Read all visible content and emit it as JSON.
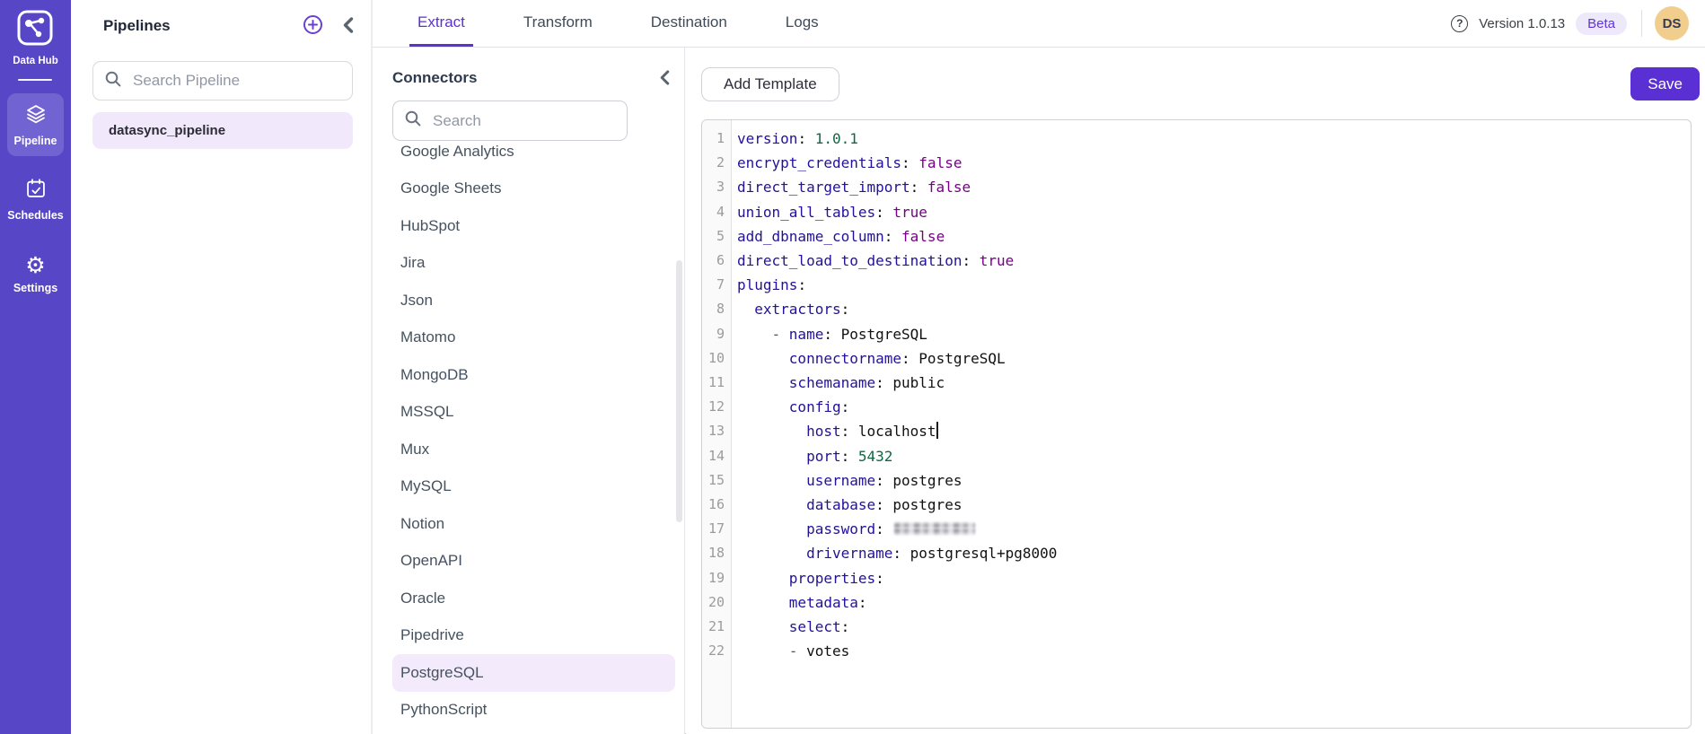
{
  "colors": {
    "sidebar_bg": "#5746C6",
    "sidebar_active_bg": "#7163D1",
    "accent": "#5F2FD0",
    "save_button_bg": "#5A2FD4",
    "selected_item_bg": "#F3EAFB",
    "beta_badge_bg": "#EDE8FA",
    "beta_badge_text": "#5F35D6",
    "avatar_bg": "#F1CE8E",
    "code_key": "#221199",
    "code_number": "#116644",
    "code_keyword": "#770088"
  },
  "sidebar": {
    "app_name": "Data Hub",
    "items": [
      {
        "label": "Pipeline",
        "icon": "layers-icon",
        "active": true
      },
      {
        "label": "Schedules",
        "icon": "calendar-check-icon",
        "active": false
      },
      {
        "label": "Settings",
        "icon": "gear-icon",
        "active": false
      }
    ]
  },
  "pipelines_panel": {
    "title": "Pipelines",
    "search_placeholder": "Search Pipeline",
    "items": [
      {
        "label": "datasync_pipeline",
        "selected": true
      }
    ]
  },
  "tabs": [
    {
      "label": "Extract",
      "active": true
    },
    {
      "label": "Transform",
      "active": false
    },
    {
      "label": "Destination",
      "active": false
    },
    {
      "label": "Logs",
      "active": false
    }
  ],
  "topbar_right": {
    "version_label": "Version 1.0.13",
    "beta_label": "Beta",
    "avatar_initials": "DS"
  },
  "connectors": {
    "title": "Connectors",
    "search_placeholder": "Search",
    "items": [
      {
        "label": "Google Analytics",
        "selected": false
      },
      {
        "label": "Google Sheets",
        "selected": false
      },
      {
        "label": "HubSpot",
        "selected": false
      },
      {
        "label": "Jira",
        "selected": false
      },
      {
        "label": "Json",
        "selected": false
      },
      {
        "label": "Matomo",
        "selected": false
      },
      {
        "label": "MongoDB",
        "selected": false
      },
      {
        "label": "MSSQL",
        "selected": false
      },
      {
        "label": "Mux",
        "selected": false
      },
      {
        "label": "MySQL",
        "selected": false
      },
      {
        "label": "Notion",
        "selected": false
      },
      {
        "label": "OpenAPI",
        "selected": false
      },
      {
        "label": "Oracle",
        "selected": false
      },
      {
        "label": "Pipedrive",
        "selected": false
      },
      {
        "label": "PostgreSQL",
        "selected": true
      },
      {
        "label": "PythonScript",
        "selected": false
      }
    ]
  },
  "toolbar": {
    "add_template_label": "Add Template",
    "save_label": "Save"
  },
  "editor": {
    "lines": [
      {
        "tokens": [
          [
            "key",
            "version"
          ],
          [
            "plain",
            ": "
          ],
          [
            "num",
            "1.0.1"
          ]
        ]
      },
      {
        "tokens": [
          [
            "key",
            "encrypt_credentials"
          ],
          [
            "plain",
            ": "
          ],
          [
            "bool",
            "false"
          ]
        ]
      },
      {
        "tokens": [
          [
            "key",
            "direct_target_import"
          ],
          [
            "plain",
            ": "
          ],
          [
            "bool",
            "false"
          ]
        ]
      },
      {
        "tokens": [
          [
            "key",
            "union_all_tables"
          ],
          [
            "plain",
            ": "
          ],
          [
            "bool",
            "true"
          ]
        ]
      },
      {
        "tokens": [
          [
            "key",
            "add_dbname_column"
          ],
          [
            "plain",
            ": "
          ],
          [
            "bool",
            "false"
          ]
        ]
      },
      {
        "tokens": [
          [
            "key",
            "direct_load_to_destination"
          ],
          [
            "plain",
            ": "
          ],
          [
            "bool",
            "true"
          ]
        ]
      },
      {
        "tokens": [
          [
            "key",
            "plugins"
          ],
          [
            "plain",
            ":"
          ]
        ]
      },
      {
        "tokens": [
          [
            "plain",
            "  "
          ],
          [
            "key",
            "extractors"
          ],
          [
            "plain",
            ":"
          ]
        ]
      },
      {
        "tokens": [
          [
            "plain",
            "    "
          ],
          [
            "dash",
            "- "
          ],
          [
            "key",
            "name"
          ],
          [
            "plain",
            ": "
          ],
          [
            "str",
            "PostgreSQL"
          ]
        ]
      },
      {
        "tokens": [
          [
            "plain",
            "      "
          ],
          [
            "key",
            "connectorname"
          ],
          [
            "plain",
            ": "
          ],
          [
            "str",
            "PostgreSQL"
          ]
        ]
      },
      {
        "tokens": [
          [
            "plain",
            "      "
          ],
          [
            "key",
            "schemaname"
          ],
          [
            "plain",
            ": "
          ],
          [
            "str",
            "public"
          ]
        ]
      },
      {
        "tokens": [
          [
            "plain",
            "      "
          ],
          [
            "key",
            "config"
          ],
          [
            "plain",
            ":"
          ]
        ]
      },
      {
        "tokens": [
          [
            "plain",
            "        "
          ],
          [
            "key",
            "host"
          ],
          [
            "plain",
            ": "
          ],
          [
            "str",
            "localhost"
          ],
          [
            "cursor",
            ""
          ]
        ]
      },
      {
        "tokens": [
          [
            "plain",
            "        "
          ],
          [
            "key",
            "port"
          ],
          [
            "plain",
            ": "
          ],
          [
            "num",
            "5432"
          ]
        ]
      },
      {
        "tokens": [
          [
            "plain",
            "        "
          ],
          [
            "key",
            "username"
          ],
          [
            "plain",
            ": "
          ],
          [
            "str",
            "postgres"
          ]
        ]
      },
      {
        "tokens": [
          [
            "plain",
            "        "
          ],
          [
            "key",
            "database"
          ],
          [
            "plain",
            ": "
          ],
          [
            "str",
            "postgres"
          ]
        ]
      },
      {
        "tokens": [
          [
            "plain",
            "        "
          ],
          [
            "key",
            "password"
          ],
          [
            "plain",
            ": "
          ],
          [
            "blur",
            "redacted"
          ]
        ]
      },
      {
        "tokens": [
          [
            "plain",
            "        "
          ],
          [
            "key",
            "drivername"
          ],
          [
            "plain",
            ": "
          ],
          [
            "str",
            "postgresql+pg8000"
          ]
        ]
      },
      {
        "tokens": [
          [
            "plain",
            "      "
          ],
          [
            "key",
            "properties"
          ],
          [
            "plain",
            ":"
          ]
        ]
      },
      {
        "tokens": [
          [
            "plain",
            "      "
          ],
          [
            "key",
            "metadata"
          ],
          [
            "plain",
            ":"
          ]
        ]
      },
      {
        "tokens": [
          [
            "plain",
            "      "
          ],
          [
            "key",
            "select"
          ],
          [
            "plain",
            ":"
          ]
        ]
      },
      {
        "tokens": [
          [
            "plain",
            "      "
          ],
          [
            "dash",
            "- "
          ],
          [
            "str",
            "votes"
          ]
        ]
      }
    ]
  }
}
